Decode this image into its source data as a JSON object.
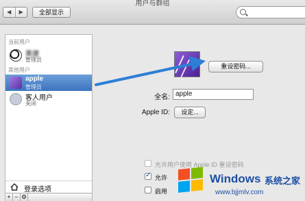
{
  "window": {
    "title": "用户与群组"
  },
  "toolbar": {
    "back_icon": "◀",
    "forward_icon": "▶",
    "show_all": "全部显示",
    "search_placeholder": ""
  },
  "sidebar": {
    "current_section": "当前用户",
    "other_section": "其他用户",
    "users": [
      {
        "name": "黄建",
        "role": "管理员",
        "avatar": "soccer-ball",
        "selected": false
      },
      {
        "name": "apple",
        "role": "管理员",
        "avatar": "purple-photo",
        "selected": true
      },
      {
        "name": "客人用户",
        "role": "关闭",
        "avatar": "guest",
        "selected": false
      }
    ],
    "login_options": "登录选项",
    "add_icon": "+",
    "remove_icon": "−",
    "gear_icon": "⚙"
  },
  "main": {
    "reset_password": "重设密码...",
    "fullname_label": "全名:",
    "fullname_value": "apple",
    "appleid_label": "Apple ID:",
    "appleid_button": "设定...",
    "allow_appleid_reset": "允许用户使用 Apple ID 重设密码",
    "allow_admin": "允许",
    "enable_parental": "启用"
  },
  "watermark": {
    "brand": "Windows",
    "cn": "系统之家",
    "url": "www.bjjmlv.com"
  },
  "colors": {
    "selection": "#3c73c0",
    "arrow": "#2d7fd6",
    "brand": "#1d4fa5"
  }
}
